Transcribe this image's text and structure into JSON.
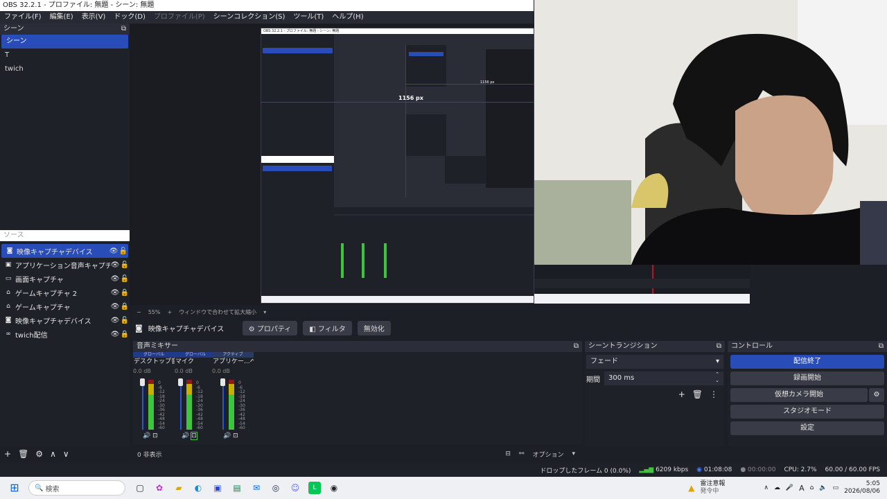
{
  "window": {
    "title": "OBS 32.2.1 - プロファイル: 無題 - シーン: 無題"
  },
  "menu": [
    {
      "label": "ファイル(F)",
      "disabled": false
    },
    {
      "label": "編集(E)",
      "disabled": false
    },
    {
      "label": "表示(V)",
      "disabled": false
    },
    {
      "label": "ドック(D)",
      "disabled": false
    },
    {
      "label": "プロファイル(P)",
      "disabled": true
    },
    {
      "label": "シーンコレクション(S)",
      "disabled": false
    },
    {
      "label": "ツール(T)",
      "disabled": false
    },
    {
      "label": "ヘルプ(H)",
      "disabled": false
    }
  ],
  "scenes": {
    "title": "シーン",
    "items": [
      "シーン",
      "T",
      "twich"
    ],
    "selected_index": 0
  },
  "sources": {
    "title": "ソース",
    "items": [
      {
        "label": "映像キャプチャデバイス",
        "icon": "camera-icon"
      },
      {
        "label": "アプリケーション音声キャプチャ (ベータ)",
        "icon": "app-audio-icon"
      },
      {
        "label": "画面キャプチャ",
        "icon": "monitor-icon"
      },
      {
        "label": "ゲームキャプチャ 2",
        "icon": "gamepad-icon"
      },
      {
        "label": "ゲームキャプチャ",
        "icon": "gamepad-icon"
      },
      {
        "label": "映像キャプチャデバイス",
        "icon": "camera-icon"
      },
      {
        "label": "twich配信",
        "icon": "link-icon"
      }
    ],
    "selected_index": 0
  },
  "preview": {
    "zoom": "55%",
    "fit_label": "ウィンドウで合わせて拡大縮小",
    "nested_title": "OBS 32.2.1 - プロファイル: 無題 - シーン: 無題",
    "nested_measure": "1156 px",
    "nested_measure_small": "1156 px"
  },
  "source_toolbar": {
    "selected_source": "映像キャプチャデバイス",
    "properties": "プロパティ",
    "filters": "フィルタ",
    "disable": "無効化"
  },
  "mixer": {
    "title": "音声ミキサー",
    "channels": [
      {
        "badge": "グローバル",
        "name": "デスクトップ音声",
        "db": "0.0 dB"
      },
      {
        "badge": "グローバル",
        "name": "マイク",
        "db": "0.0 dB"
      },
      {
        "badge": "アクティブ",
        "name": "アプリケー...ベータ版)",
        "db": "0.0 dB"
      }
    ],
    "scale": [
      "0",
      "-6",
      "-12",
      "-18",
      "-24",
      "-30",
      "-36",
      "-42",
      "-48",
      "-54",
      "-60"
    ],
    "hidden_count": "0 非表示",
    "options_label": "オプション"
  },
  "transitions": {
    "title": "シーントランジション",
    "type": "フェード",
    "duration_label": "期間",
    "duration_value": "300 ms"
  },
  "controls": {
    "title": "コントロール",
    "stop_stream": "配信終了",
    "start_recording": "録画開始",
    "start_vcam": "仮想カメラ開始",
    "studio_mode": "スタジオモード",
    "settings": "設定"
  },
  "status": {
    "dropped_frames": "ドロップしたフレーム 0 (0.0%)",
    "bitrate": "6209 kbps",
    "stream_time": "01:08:08",
    "rec_time": "00:00:00",
    "cpu": "CPU: 2.7%",
    "fps": "60.00 / 60.00 FPS"
  },
  "taskbar": {
    "search_placeholder": "検索",
    "weather_title": "雷注意報",
    "weather_sub": "発令中",
    "time": "5:05",
    "date": "2026/08/06"
  },
  "colors": {
    "accent": "#284cb8",
    "panel": "#1f2129",
    "background": "#1d1f26"
  }
}
